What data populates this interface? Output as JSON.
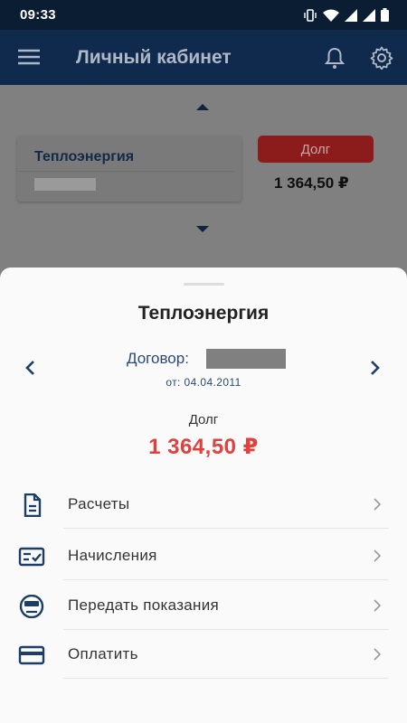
{
  "status_bar": {
    "time": "09:33"
  },
  "app_bar": {
    "title": "Личный кабинет"
  },
  "background": {
    "service_name": "Теплоэнергия",
    "debt_badge": "Долг",
    "amount": "1 364,50 ₽"
  },
  "sheet": {
    "title": "Теплоэнергия",
    "contract_label": "Договор:",
    "contract_date": "от: 04.04.2011",
    "debt_label": "Долг",
    "debt_amount": "1 364,50 ₽",
    "menu": [
      {
        "label": "Расчеты",
        "icon": "document-icon"
      },
      {
        "label": "Начисления",
        "icon": "checklist-icon"
      },
      {
        "label": "Передать показания",
        "icon": "meter-icon"
      },
      {
        "label": "Оплатить",
        "icon": "card-icon"
      }
    ]
  },
  "colors": {
    "accent": "#0f2a4d",
    "debt": "#e0413e",
    "icon": "#1c3d66"
  }
}
